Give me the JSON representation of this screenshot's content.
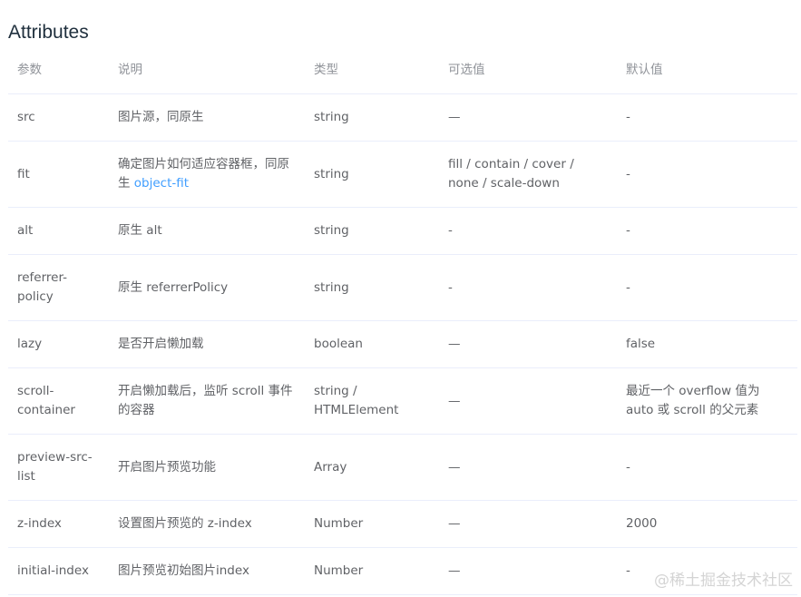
{
  "title": "Attributes",
  "headers": [
    "参数",
    "说明",
    "类型",
    "可选值",
    "默认值"
  ],
  "rows": [
    {
      "param": "src",
      "desc": "图片源，同原生",
      "desc_link": "",
      "type": "string",
      "options": "—",
      "default": "-"
    },
    {
      "param": "fit",
      "desc": "确定图片如何适应容器框，同原生 ",
      "desc_link": "object-fit",
      "type": "string",
      "options": "fill / contain / cover / none / scale-down",
      "default": "-"
    },
    {
      "param": "alt",
      "desc": "原生 alt",
      "desc_link": "",
      "type": "string",
      "options": "-",
      "default": "-"
    },
    {
      "param": "referrer-policy",
      "desc": "原生 referrerPolicy",
      "desc_link": "",
      "type": "string",
      "options": "-",
      "default": "-"
    },
    {
      "param": "lazy",
      "desc": "是否开启懒加载",
      "desc_link": "",
      "type": "boolean",
      "options": "—",
      "default": "false"
    },
    {
      "param": "scroll-container",
      "desc": "开启懒加载后，监听 scroll 事件的容器",
      "desc_link": "",
      "type": "string / HTMLElement",
      "options": "—",
      "default": "最近一个 overflow 值为 auto 或 scroll 的父元素"
    },
    {
      "param": "preview-src-list",
      "desc": "开启图片预览功能",
      "desc_link": "",
      "type": "Array",
      "options": "—",
      "default": "-"
    },
    {
      "param": "z-index",
      "desc": "设置图片预览的 z-index",
      "desc_link": "",
      "type": "Number",
      "options": "—",
      "default": "2000"
    },
    {
      "param": "initial-index",
      "desc": "图片预览初始图片index",
      "desc_link": "",
      "type": "Number",
      "options": "—",
      "default": "-"
    }
  ],
  "watermark": "@稀土掘金技术社区"
}
